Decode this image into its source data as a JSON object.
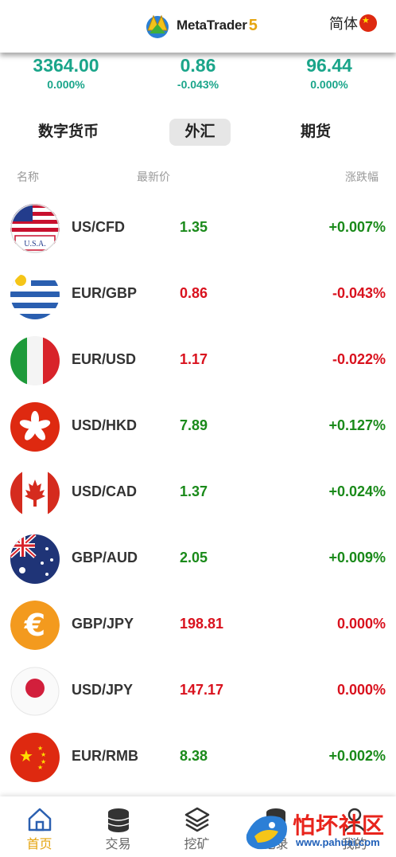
{
  "header": {
    "brand": "MetaTrader",
    "brand_suffix": "5",
    "language_label": "简体",
    "language_flag_icon": "china-flag-icon"
  },
  "tickers": [
    {
      "price": "3364.00",
      "change": "0.000%"
    },
    {
      "price": "0.86",
      "change": "-0.043%"
    },
    {
      "price": "96.44",
      "change": "0.000%"
    }
  ],
  "tabs": [
    {
      "label": "数字货币",
      "active": false
    },
    {
      "label": "外汇",
      "active": true
    },
    {
      "label": "期货",
      "active": false
    }
  ],
  "columns": {
    "name": "名称",
    "price": "最新价",
    "change": "涨跌幅"
  },
  "colors": {
    "up": "#1a8a1a",
    "down": "#d9121e",
    "ticker": "#1aa58a",
    "nav_active": "#e5a511"
  },
  "rows": [
    {
      "flag": "usa-flag-icon",
      "pair": "US/CFD",
      "price": "1.35",
      "change": "+0.007%",
      "direction": "up"
    },
    {
      "flag": "uruguay-flag-icon",
      "pair": "EUR/GBP",
      "price": "0.86",
      "change": "-0.043%",
      "direction": "down"
    },
    {
      "flag": "italy-flag-icon",
      "pair": "EUR/USD",
      "price": "1.17",
      "change": "-0.022%",
      "direction": "down"
    },
    {
      "flag": "hongkong-flag-icon",
      "pair": "USD/HKD",
      "price": "7.89",
      "change": "+0.127%",
      "direction": "up"
    },
    {
      "flag": "canada-flag-icon",
      "pair": "USD/CAD",
      "price": "1.37",
      "change": "+0.024%",
      "direction": "up"
    },
    {
      "flag": "australia-flag-icon",
      "pair": "GBP/AUD",
      "price": "2.05",
      "change": "+0.009%",
      "direction": "up"
    },
    {
      "flag": "euro-icon",
      "pair": "GBP/JPY",
      "price": "198.81",
      "change": "0.000%",
      "direction": "down"
    },
    {
      "flag": "japan-flag-icon",
      "pair": "USD/JPY",
      "price": "147.17",
      "change": "0.000%",
      "direction": "down"
    },
    {
      "flag": "china-flag-icon",
      "pair": "EUR/RMB",
      "price": "8.38",
      "change": "+0.002%",
      "direction": "up"
    }
  ],
  "usa_flag_caption": "U.S.A.",
  "nav": [
    {
      "label": "首页",
      "icon": "home-icon",
      "active": true
    },
    {
      "label": "交易",
      "icon": "coins-icon",
      "active": false
    },
    {
      "label": "挖矿",
      "icon": "layers-icon",
      "active": false
    },
    {
      "label": "记录",
      "icon": "coins-stack-icon",
      "active": false
    },
    {
      "label": "我的",
      "icon": "user-icon",
      "active": false
    }
  ],
  "watermark": {
    "text": "怕坏社区",
    "url": "www.pahuai.com"
  }
}
